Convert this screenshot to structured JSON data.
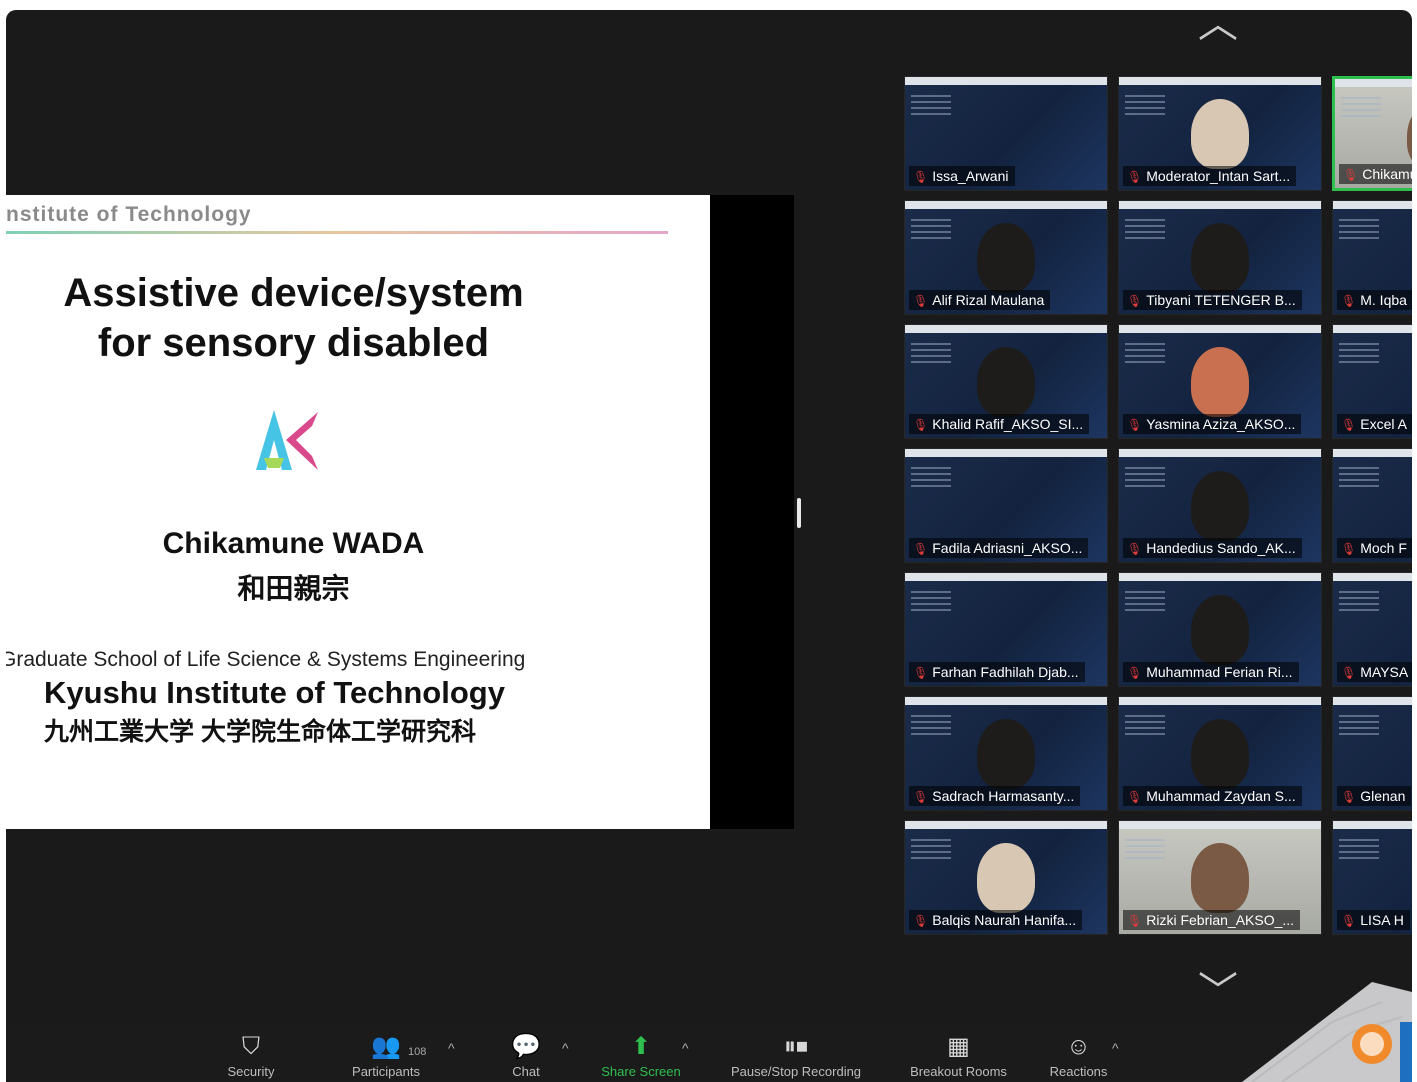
{
  "slide": {
    "institute_header": "nstitute of Technology",
    "title_line1": "Assistive device/system",
    "title_line2": "for sensory disabled",
    "author_en": "Chikamune WADA",
    "author_jp": "和田親宗",
    "graduate_school": "Graduate School of Life Science & Systems Engineering",
    "university": "Kyushu Institute of Technology",
    "university_jp": "九州工業大学 大学院生命体工学研究科"
  },
  "gallery": {
    "tiles": [
      {
        "name": "Issa_Arwani"
      },
      {
        "name": "Moderator_Intan Sart..."
      },
      {
        "name": "Chikamun"
      },
      {
        "name": "Alif Rizal Maulana"
      },
      {
        "name": "Tibyani TETENGER B..."
      },
      {
        "name": "M. Iqba"
      },
      {
        "name": "Khalid Rafif_AKSO_SI..."
      },
      {
        "name": "Yasmina Aziza_AKSO..."
      },
      {
        "name": "Excel A"
      },
      {
        "name": "Fadila Adriasni_AKSO..."
      },
      {
        "name": "Handedius Sando_AK..."
      },
      {
        "name": "Moch F"
      },
      {
        "name": "Farhan Fadhilah Djab..."
      },
      {
        "name": "Muhammad Ferian Ri..."
      },
      {
        "name": "MAYSA"
      },
      {
        "name": "Sadrach Harmasanty..."
      },
      {
        "name": "Muhammad Zaydan S..."
      },
      {
        "name": "Glenan"
      },
      {
        "name": "Balqis Naurah Hanifa..."
      },
      {
        "name": "Rizki Febrian_AKSO_..."
      },
      {
        "name": "LISA H"
      }
    ]
  },
  "toolbar": {
    "security": "Security",
    "participants": "Participants",
    "participant_count": "108",
    "chat": "Chat",
    "share_screen": "Share Screen",
    "recording": "Pause/Stop Recording",
    "breakout": "Breakout Rooms",
    "reactions": "Reactions"
  },
  "colors": {
    "background": "#1a1a1a",
    "active_speaker": "#2fbf4f",
    "share_green": "#2fbf4f",
    "muted_red": "#e23b3b"
  }
}
